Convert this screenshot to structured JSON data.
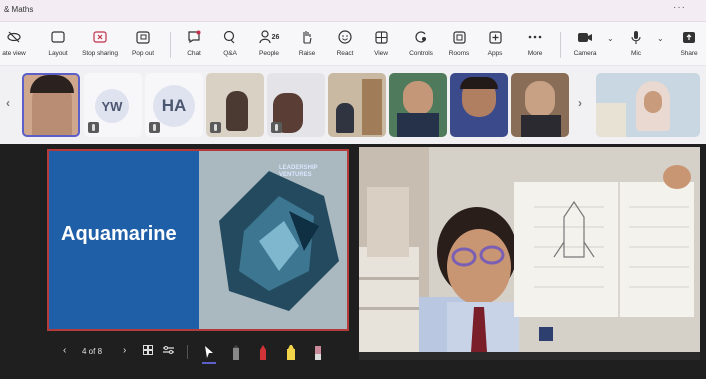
{
  "app": {
    "title": "& Maths",
    "more": "···"
  },
  "toolbar": {
    "items": [
      {
        "id": "private-view",
        "label": "ate view"
      },
      {
        "id": "layout",
        "label": "Layout"
      },
      {
        "id": "stop-sharing",
        "label": "Stop sharing"
      },
      {
        "id": "pop-out",
        "label": "Pop out"
      },
      {
        "id": "chat",
        "label": "Chat"
      },
      {
        "id": "qa",
        "label": "Q&A"
      },
      {
        "id": "people",
        "label": "People",
        "badge": "26"
      },
      {
        "id": "raise",
        "label": "Raise"
      },
      {
        "id": "react",
        "label": "React"
      },
      {
        "id": "view",
        "label": "View"
      },
      {
        "id": "controls",
        "label": "Controls"
      },
      {
        "id": "rooms",
        "label": "Rooms"
      },
      {
        "id": "apps",
        "label": "Apps"
      },
      {
        "id": "more",
        "label": "More"
      },
      {
        "id": "camera",
        "label": "Camera"
      },
      {
        "id": "mic",
        "label": "Mic"
      },
      {
        "id": "share",
        "label": "Share"
      }
    ],
    "accent": "#5b5fc7",
    "stop_color": "#c4314b"
  },
  "participants": {
    "tiles": [
      {
        "type": "video",
        "active": true
      },
      {
        "type": "avatar",
        "initials": "YW"
      },
      {
        "type": "avatar",
        "initials": "HA"
      },
      {
        "type": "video"
      },
      {
        "type": "video"
      },
      {
        "type": "video"
      },
      {
        "type": "video"
      },
      {
        "type": "video"
      },
      {
        "type": "video"
      },
      {
        "type": "video"
      }
    ],
    "prev": "‹",
    "next": "›"
  },
  "presentation": {
    "slide_title": "Aquamarine",
    "brand_line1": "LEADERSHIP",
    "brand_line2": "VENTURES",
    "counter": "4 of 8",
    "prev": "‹",
    "next": "›"
  }
}
